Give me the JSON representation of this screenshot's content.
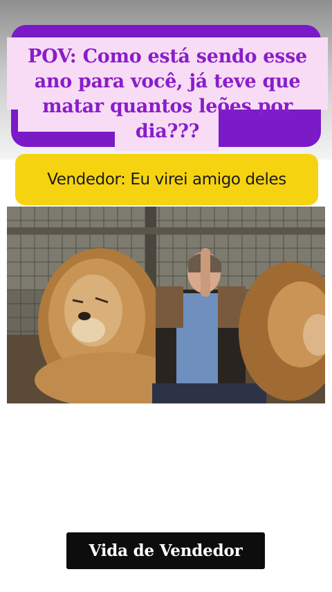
{
  "caption": {
    "pov_text": "POV: Como está sendo esse ano para você, já teve que matar quantos leões por dia???",
    "vendor_text": "Vendedor: Eu virei amigo deles"
  },
  "photo": {
    "subject": "man-sitting-between-two-lions-icon"
  },
  "footer": {
    "label": "Vida de Vendedor"
  },
  "colors": {
    "purple": "#7a1bc7",
    "pink": "#f8dcf5",
    "yellow": "#f5d311",
    "label_bg": "#0d0d0d"
  }
}
